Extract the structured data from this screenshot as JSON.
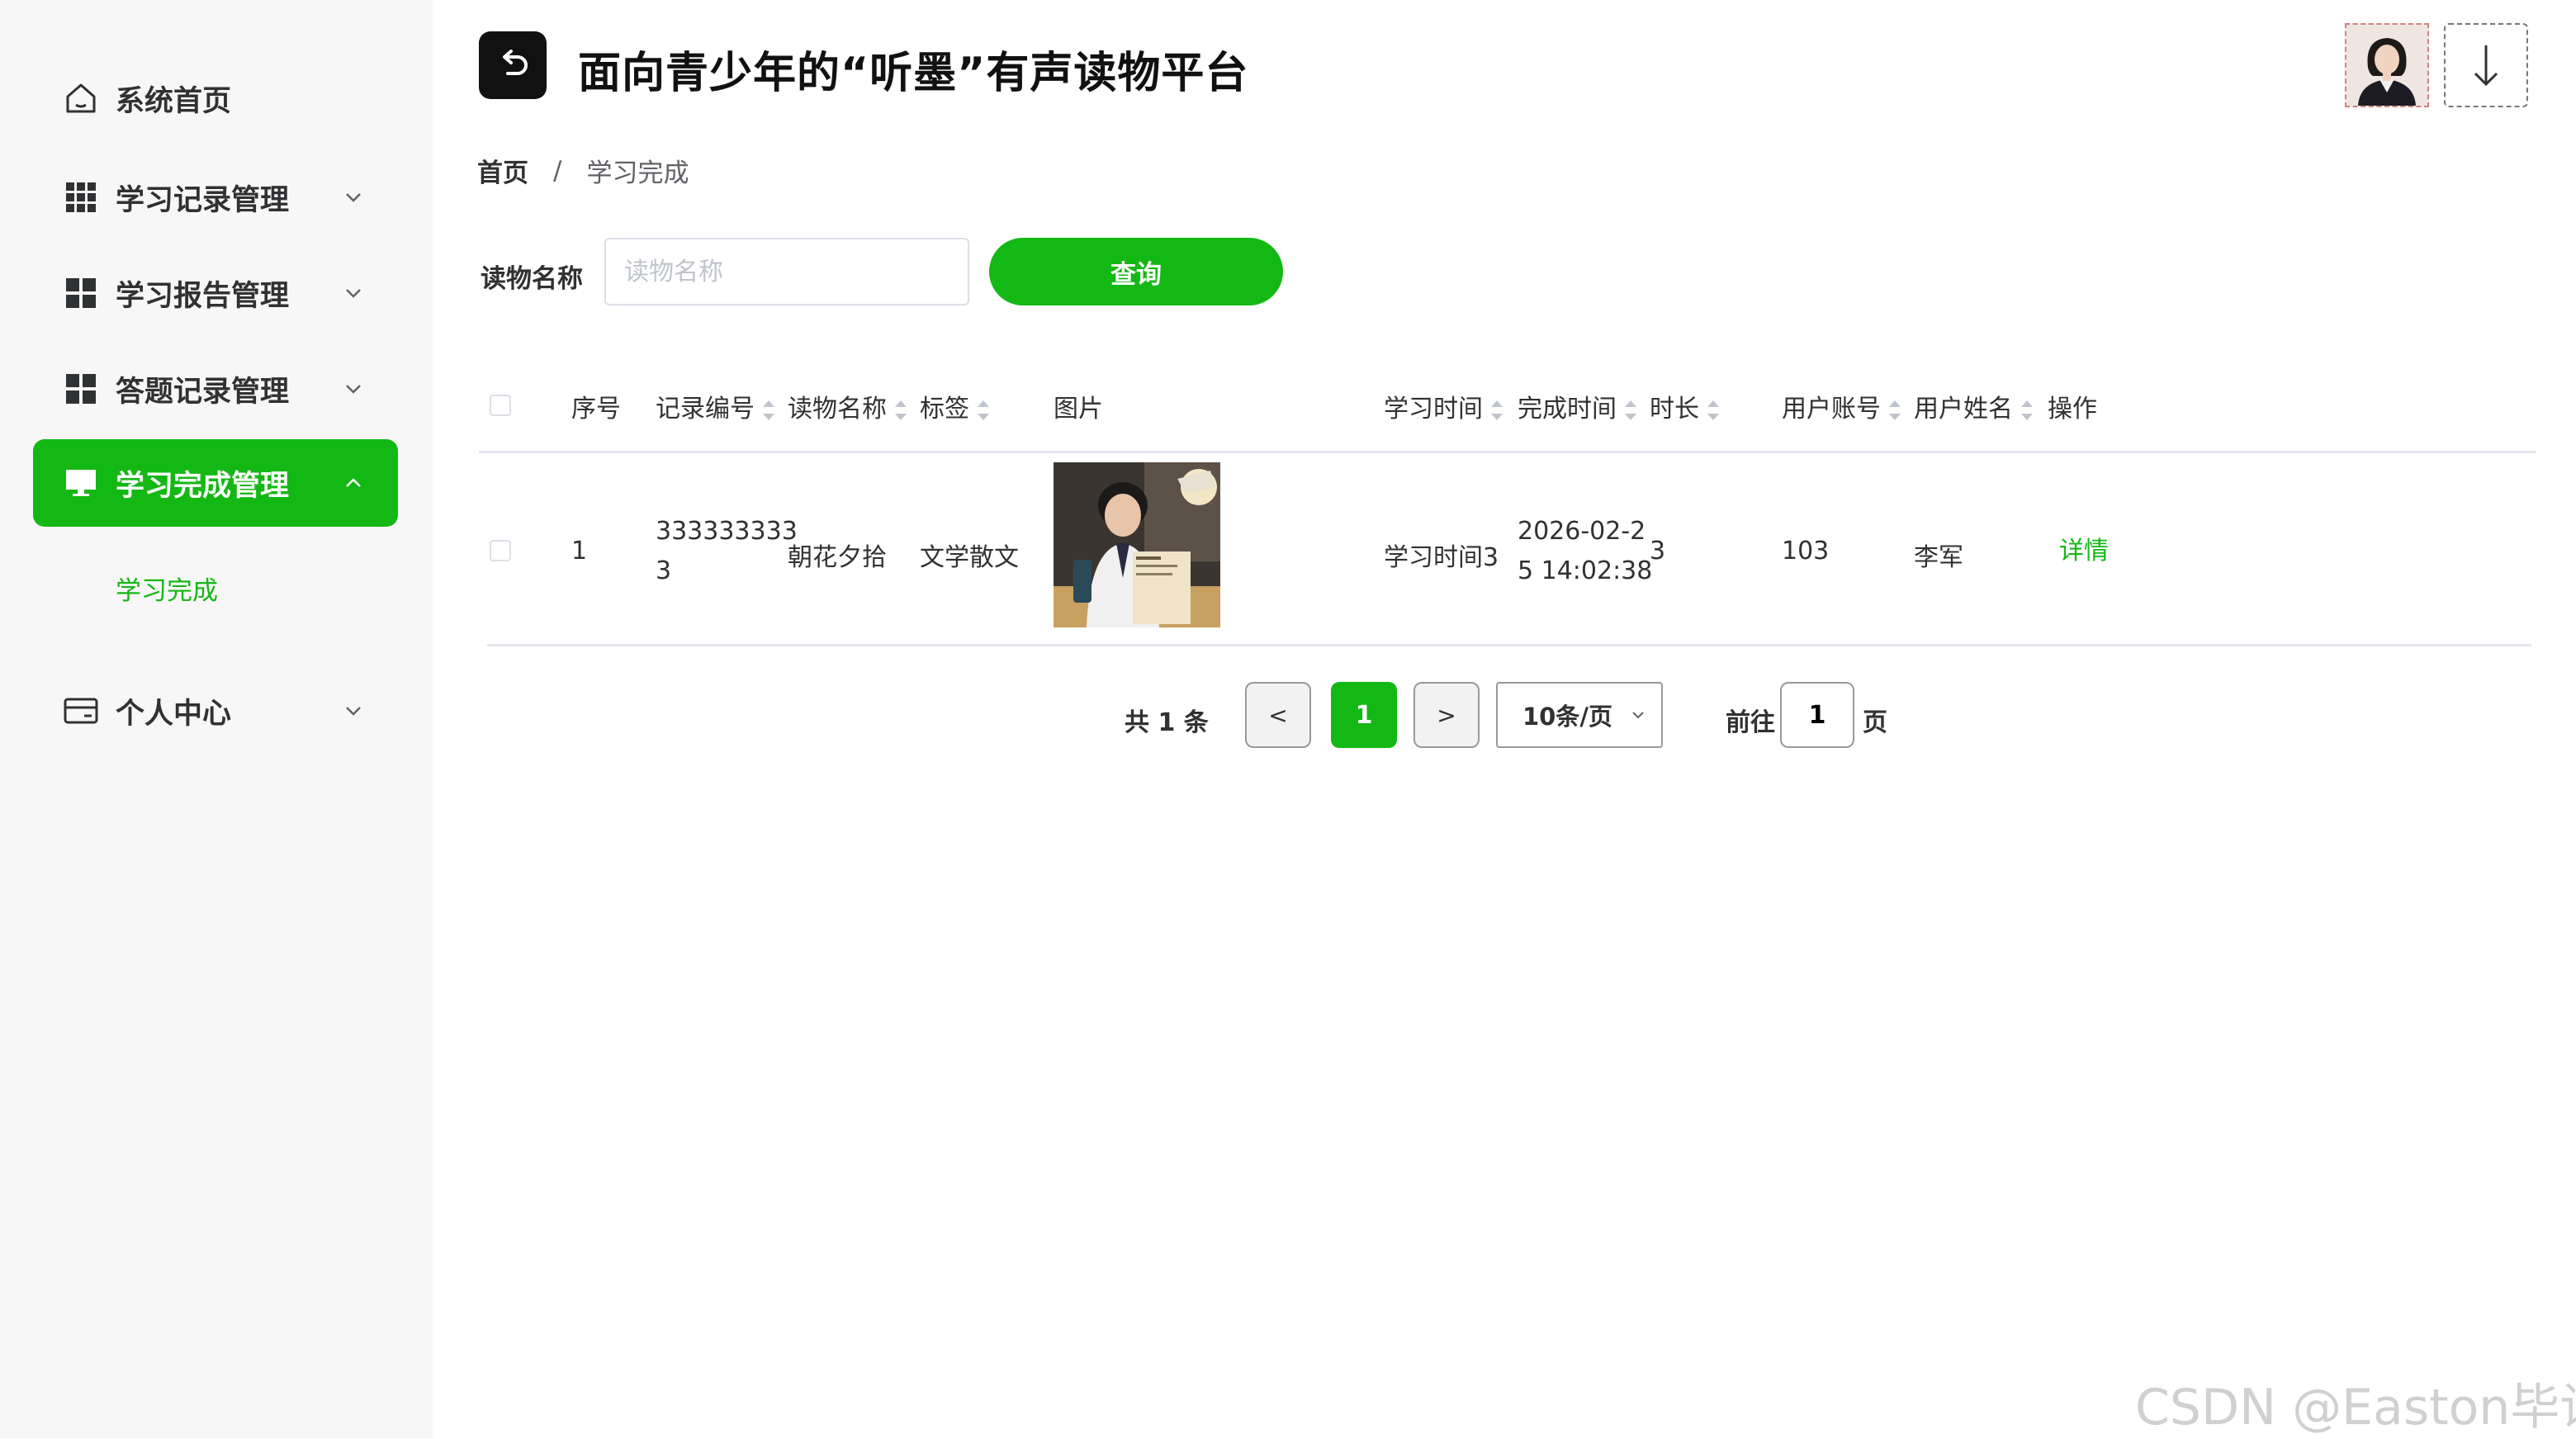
{
  "app": {
    "title": "面向青少年的“听墨”有声读物平台"
  },
  "sidebar": {
    "items": [
      {
        "label": "系统首页",
        "icon": "home-icon",
        "expandable": false
      },
      {
        "label": "学习记录管理",
        "icon": "grid-icon",
        "expandable": true
      },
      {
        "label": "学习报告管理",
        "icon": "grid-icon",
        "expandable": true
      },
      {
        "label": "答题记录管理",
        "icon": "grid-icon",
        "expandable": true
      },
      {
        "label": "学习完成管理",
        "icon": "monitor-icon",
        "expandable": true,
        "active": true
      },
      {
        "label": "个人中心",
        "icon": "card-icon",
        "expandable": true
      }
    ],
    "submenu": {
      "label": "学习完成"
    }
  },
  "breadcrumb": {
    "home": "首页",
    "separator": "/",
    "current": "学习完成"
  },
  "search": {
    "label": "读物名称",
    "placeholder": "读物名称",
    "value": "",
    "button": "查询"
  },
  "table": {
    "columns": [
      "序号",
      "记录编号",
      "读物名称",
      "标签",
      "图片",
      "学习时间",
      "完成时间",
      "时长",
      "用户账号",
      "用户姓名",
      "操作"
    ],
    "rows": [
      {
        "index": "1",
        "record_no_1": "333333333",
        "record_no_2": "3",
        "book_name": "朝花夕拾",
        "tag": "文学散文",
        "image": "reading-boy-photo",
        "study_time": "学习时间3",
        "finish_time_1": "2026-02-2",
        "finish_time_2": "5 14:02:38",
        "duration": "3",
        "account": "103",
        "username": "李军",
        "action": "详情"
      }
    ]
  },
  "pagination": {
    "total_label": "共 1 条",
    "prev": "<",
    "current_page": "1",
    "next": ">",
    "page_size": "10条/页",
    "goto_label": "前往",
    "goto_value": "1",
    "page_suffix": "页"
  },
  "watermark": "CSDN @Easton毕设",
  "colors": {
    "accent": "#14b814",
    "sidebar_bg": "#f7f7f7",
    "header_button": "#111111"
  }
}
